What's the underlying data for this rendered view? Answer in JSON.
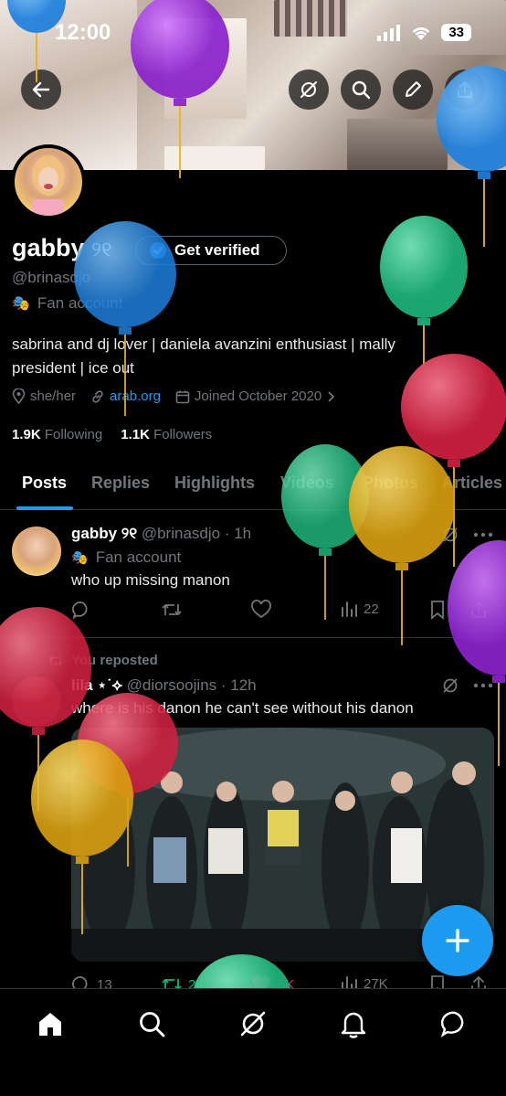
{
  "status": {
    "time": "12:00",
    "battery": "33"
  },
  "profile": {
    "name": "gabby",
    "name_symbols": "୨୧",
    "handle": "@brinasdjo",
    "category": "Fan account",
    "verify_label": "Get verified",
    "bio_line1": "sabrina and dj lover | daniela avanzini enthusiast | mally",
    "bio_line2": "president | ice out",
    "pronouns": "she/her",
    "link": "arab.org",
    "joined": "Joined October 2020",
    "following_count": "1.9K",
    "following_label": "Following",
    "followers_count": "1.1K",
    "followers_label": "Followers"
  },
  "tabs": [
    "Posts",
    "Replies",
    "Highlights",
    "Videos",
    "Photos",
    "Articles"
  ],
  "posts": [
    {
      "name": "gabby ୨୧",
      "handle": "@brinasdjo",
      "time": "1h",
      "category": "Fan account",
      "text": "who up missing manon",
      "views": "22"
    },
    {
      "repost_label": "You reposted",
      "name": "lila ⋆˙⟡",
      "handle": "@diorsoojins",
      "time": "12h",
      "text": "where is his danon he can't see without his danon",
      "replies": "13",
      "reposts": "2K",
      "likes": "5K",
      "views": "27K"
    }
  ],
  "colors": {
    "accent": "#1d9bf0",
    "background": "#000000",
    "muted": "#71767b",
    "balloon_purple": "#9b30d9",
    "balloon_blue": "#2a8fe6",
    "balloon_green": "#2ec98a",
    "balloon_red": "#e0304f",
    "balloon_yellow": "#e9b41c"
  }
}
